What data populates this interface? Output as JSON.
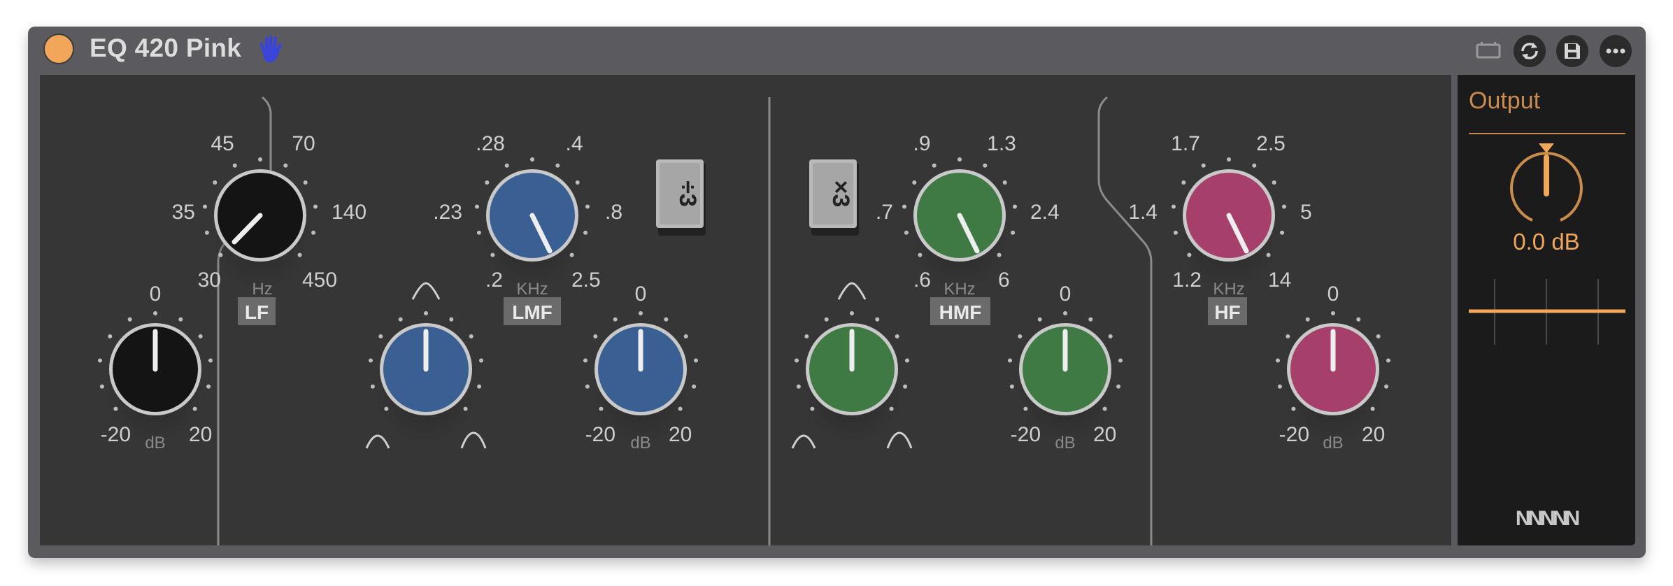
{
  "title": "EQ 420 Pink",
  "colors": {
    "power": "#f2a65a",
    "lf": "#141414",
    "lmf": "#3a5f93",
    "hmf": "#3f7a44",
    "hf": "#a6406b",
    "output_accent": "#f2a65a",
    "hand": "#3b44d8"
  },
  "header_icons": [
    "hot-swap-icon",
    "refresh-icon",
    "save-icon",
    "more-icon"
  ],
  "bands": {
    "lf": {
      "tag": "LF",
      "freq": {
        "scale": [
          "30",
          "35",
          "45",
          "70",
          "140",
          "450"
        ],
        "unit": "Hz"
      },
      "gain": {
        "top": "0",
        "min": "-20",
        "max": "20",
        "unit": "dB"
      }
    },
    "lmf": {
      "tag": "LMF",
      "freq": {
        "scale": [
          ".2",
          ".23",
          ".28",
          ".4",
          ".8",
          "2.5"
        ],
        "unit": "KHz"
      },
      "gain": {
        "top": "0",
        "min": "-20",
        "max": "20",
        "unit": "dB"
      },
      "range_button": "÷3"
    },
    "hmf": {
      "tag": "HMF",
      "freq": {
        "scale": [
          ".6",
          ".7",
          ".9",
          "1.3",
          "2.4",
          "6"
        ],
        "unit": "KHz"
      },
      "gain": {
        "top": "0",
        "min": "-20",
        "max": "20",
        "unit": "dB"
      },
      "range_button": "×3"
    },
    "hf": {
      "tag": "HF",
      "freq": {
        "scale": [
          "1.2",
          "1.4",
          "1.7",
          "2.5",
          "5",
          "14"
        ],
        "unit": "KHz"
      },
      "gain": {
        "top": "0",
        "min": "-20",
        "max": "20",
        "unit": "dB"
      }
    }
  },
  "output": {
    "title": "Output",
    "value": "0.0 dB",
    "logo": "NNNNN"
  }
}
